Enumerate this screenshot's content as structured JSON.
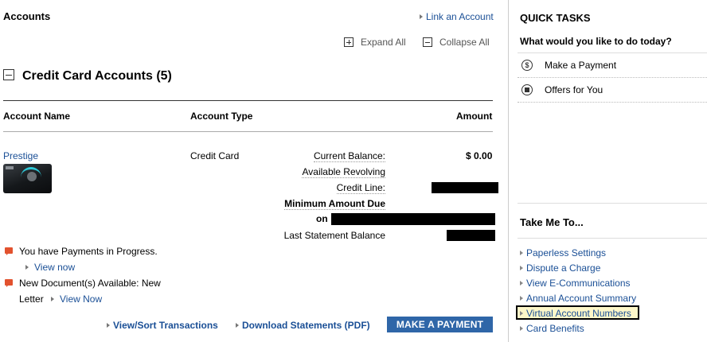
{
  "accounts": {
    "title": "Accounts",
    "link_account": "Link an Account",
    "expand_all": "Expand All",
    "collapse_all": "Collapse All",
    "section_title": "Credit Card Accounts (5)",
    "columns": {
      "account_name": "Account Name",
      "account_type": "Account Type",
      "amount": "Amount"
    },
    "row": {
      "name": "Prestige",
      "type": "Credit Card",
      "current_balance_label": "Current Balance:",
      "current_balance_value": "$ 0.00",
      "available_revolving_label": "Available Revolving",
      "credit_line_label": "Credit Line:",
      "minimum_due_label": "Minimum Amount Due",
      "minimum_due_on": "on",
      "last_statement_label": "Last Statement Balance"
    },
    "messages": {
      "payments_in_progress": "You have Payments in Progress.",
      "view_now_1": "View now",
      "new_documents": "New Document(s) Available: New",
      "letter": "Letter",
      "view_now_2": "View Now"
    },
    "actions": {
      "view_sort": "View/Sort Transactions",
      "download_statements": "Download Statements (PDF)",
      "make_payment": "MAKE A PAYMENT"
    }
  },
  "quick_tasks": {
    "title": "QUICK TASKS",
    "subtitle": "What would you like to do today?",
    "items": [
      {
        "label": "Make a Payment",
        "icon": "dollar-circle-icon"
      },
      {
        "label": "Offers for You",
        "icon": "offer-icon"
      }
    ]
  },
  "take_me_to": {
    "title": "Take Me To...",
    "items": [
      "Paperless Settings",
      "Dispute a Charge",
      "View E-Communications",
      "Annual Account Summary",
      "Virtual Account Numbers",
      "Card Benefits"
    ],
    "highlighted_index": 4
  },
  "colors": {
    "link": "#1a4f96",
    "button": "#2f66a8",
    "alert_icon": "#e2522e",
    "highlight_bg": "#fdf7c9"
  }
}
